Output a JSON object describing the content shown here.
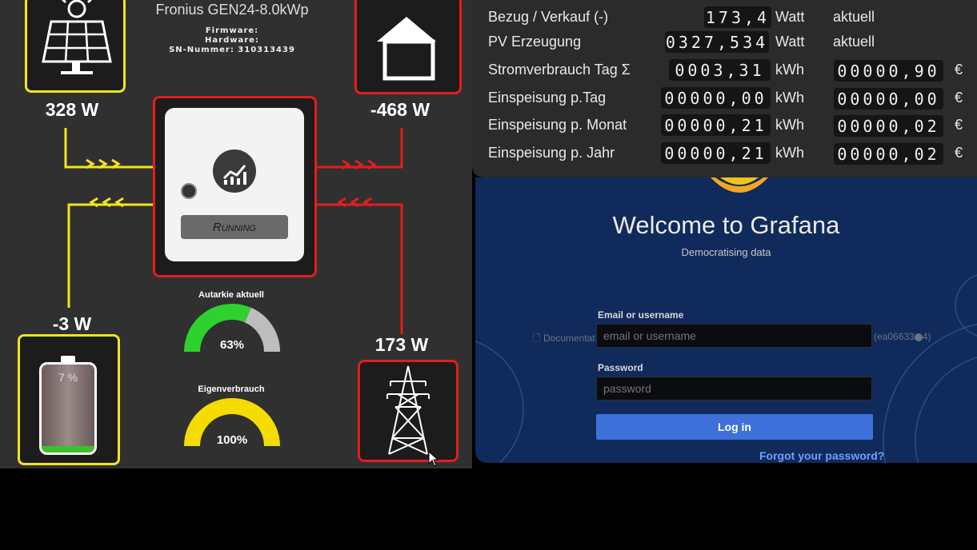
{
  "inverter": {
    "title": "Fronius GEN24-8.0kWp",
    "firmware_label": "Firmware:",
    "hardware_label": "Hardware:",
    "serial_label": "SN-Nummer: 310313439",
    "status": "Running"
  },
  "flows": {
    "pv_power": "328 W",
    "house_power": "-468 W",
    "battery_power": "-3 W",
    "grid_power": "173 W",
    "battery_soc_text": "7 %",
    "battery_soc": 0.07
  },
  "gauges": {
    "autarkie": {
      "label": "Autarkie aktuell",
      "value_text": "63%",
      "value": 63,
      "color": "#2ed12e"
    },
    "eigenverbrauch": {
      "label": "Eigenverbrauch",
      "value_text": "100%",
      "value": 100,
      "color": "#f5dc00"
    }
  },
  "meter_rows": [
    {
      "label": "Bezug / Verkauf (-)",
      "counter": "173,4",
      "unit": "Watt",
      "extra": "aktuell"
    },
    {
      "label": "PV Erzeugung",
      "counter": "0327,534",
      "unit": "Watt",
      "extra": "aktuell"
    },
    {
      "label": "Stromverbrauch Tag Σ",
      "counter": "0003,31",
      "unit": "kWh",
      "extra": "00000,90",
      "currency": "€"
    },
    {
      "label": "Einspeisung p.Tag",
      "counter": "00000,00",
      "unit": "kWh",
      "extra": "00000,00",
      "currency": "€"
    },
    {
      "label": "Einspeisung p. Monat",
      "counter": "00000,21",
      "unit": "kWh",
      "extra": "00000,02",
      "currency": "€"
    },
    {
      "label": "Einspeisung p. Jahr",
      "counter": "00000,21",
      "unit": "kWh",
      "extra": "00000,02",
      "currency": "€"
    }
  ],
  "grafana": {
    "title": "Welcome to Grafana",
    "subtitle": "Democratising data",
    "email_label": "Email or username",
    "email_placeholder": "email or username",
    "password_label": "Password",
    "password_placeholder": "password",
    "login_button": "Log in",
    "forgot_link": "Forgot your password?",
    "doc_hint": "Documentat",
    "version_hint": "(ea06633",
    "version_hint_end": "4)"
  },
  "colors": {
    "pv_line": "#f2e51e",
    "grid_line": "#e31d1d",
    "grafana_bg": "#112a5c",
    "login_button": "#3d71d9"
  }
}
